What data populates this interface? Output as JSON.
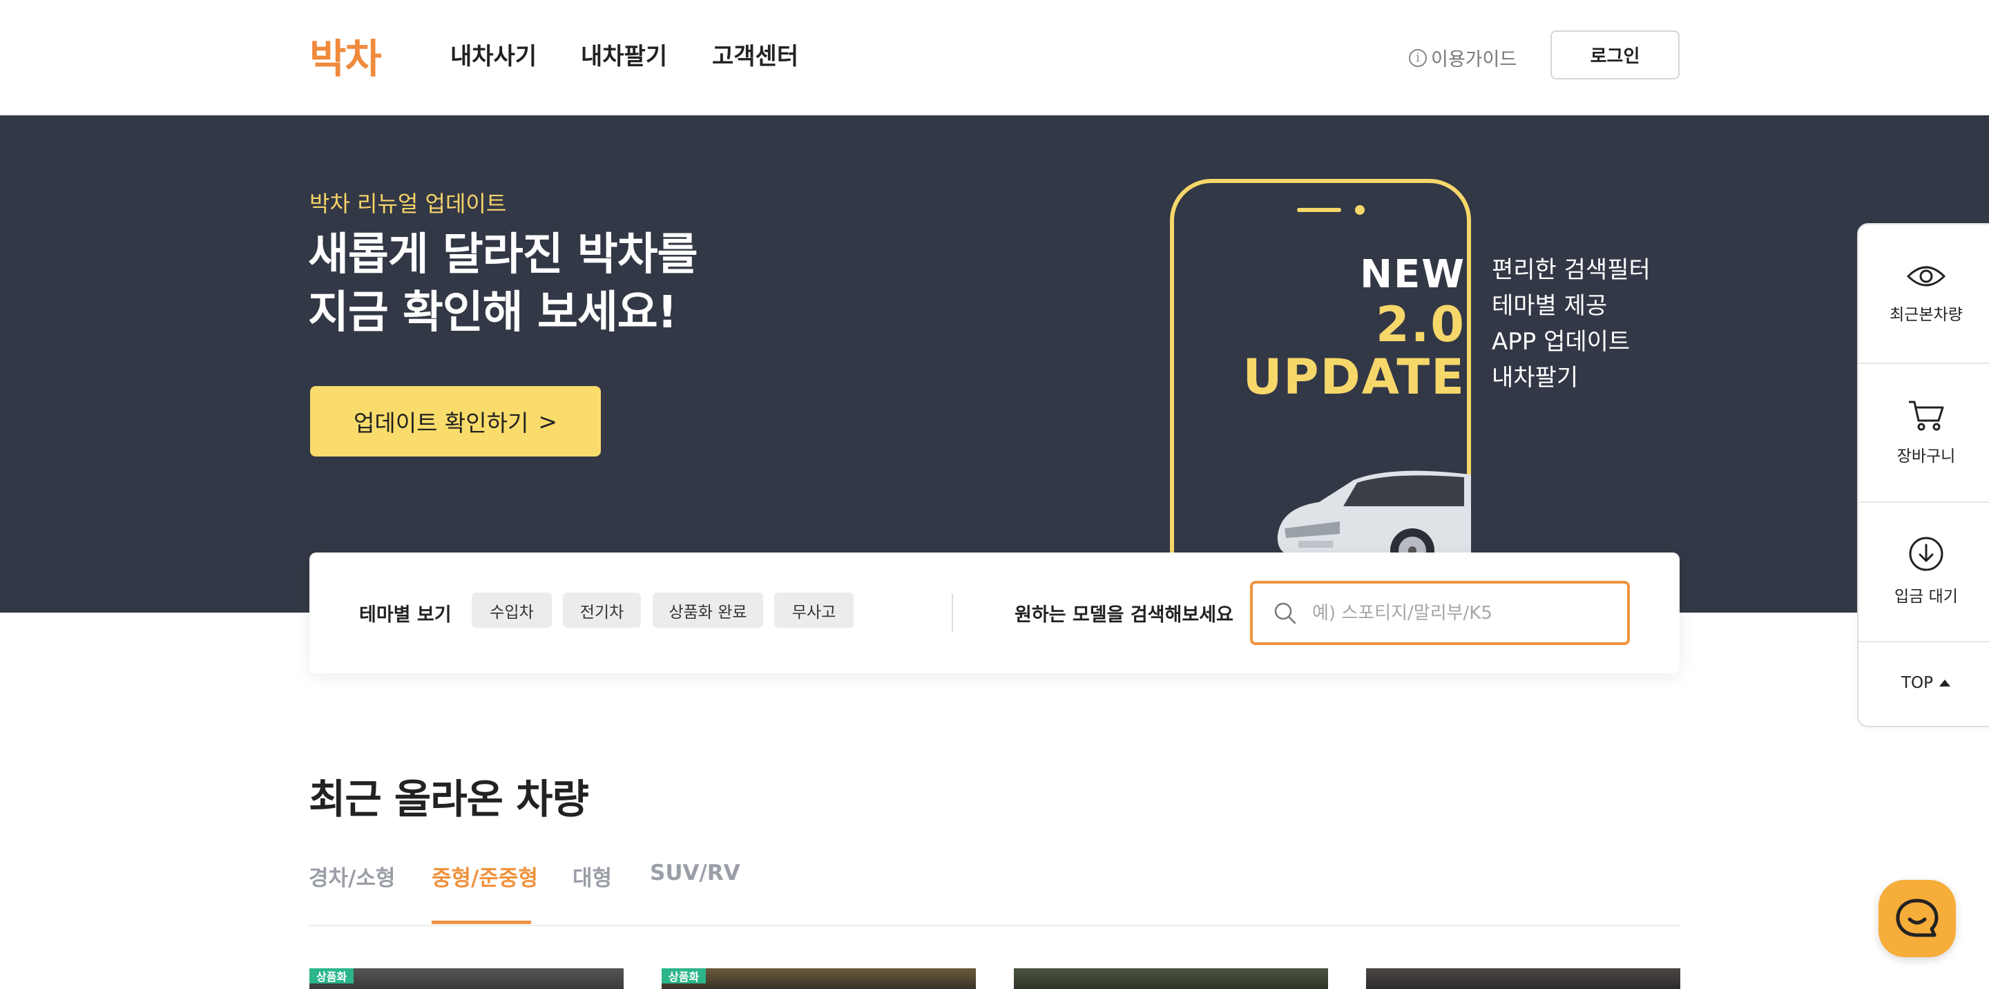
{
  "brand": {
    "logo": "박차",
    "accent": "#f08a3c",
    "hero_bg": "#333846",
    "highlight": "#f6d76a"
  },
  "header": {
    "nav": [
      "내차사기",
      "내차팔기",
      "고객센터"
    ],
    "guide_label": "이용가이드",
    "login_label": "로그인"
  },
  "hero": {
    "eyebrow": "박차 리뉴얼 업데이트",
    "title_line1": "새롭게 달라진 박차를",
    "title_line2": "지금 확인해 보세요!",
    "cta_label": "업데이트 확인하기",
    "cta_arrow": ">",
    "badge_new": "NEW",
    "badge_version": "2.0",
    "badge_update": "UPDATE",
    "features": [
      "편리한 검색필터",
      "테마별 제공",
      "APP 업데이트",
      "내차팔기"
    ]
  },
  "search_panel": {
    "theme_label": "테마별 보기",
    "chips": [
      "수입차",
      "전기차",
      "상품화 완료",
      "무사고"
    ],
    "search_label": "원하는 모델을 검색해보세요",
    "search_placeholder": "예) 스포티지/말리부/K5",
    "search_value": ""
  },
  "recent": {
    "title": "최근 올라온 차량",
    "tabs": [
      "경차/소형",
      "중형/준중형",
      "대형",
      "SUV/RV"
    ],
    "active_tab": "중형/준중형",
    "card_tags": [
      "상품화",
      "상품화"
    ]
  },
  "quickbar": {
    "items": [
      {
        "label": "최근본차량",
        "icon": "eye-icon"
      },
      {
        "label": "장바구니",
        "icon": "cart-icon"
      },
      {
        "label": "입금 대기",
        "icon": "download-circle-icon"
      }
    ],
    "top_label": "TOP"
  },
  "chat": {
    "icon": "chat-bubble-icon"
  }
}
